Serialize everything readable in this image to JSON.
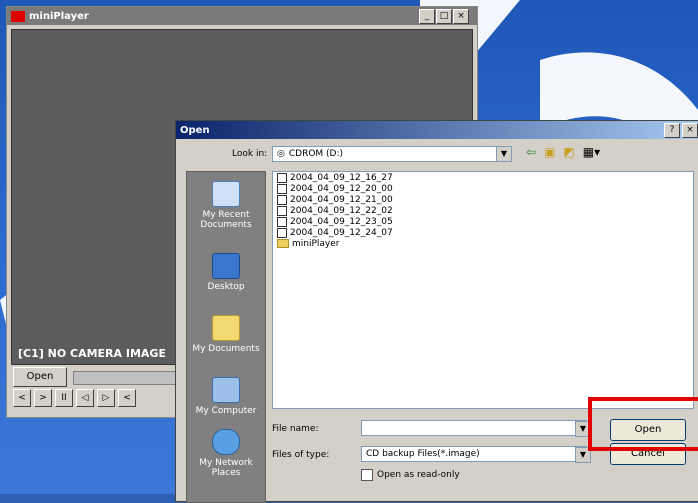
{
  "miniplayer": {
    "title": "miniPlayer",
    "status": "[C1] NO CAMERA IMAGE",
    "open_button": "Open",
    "controls": [
      "<",
      ">",
      "II",
      "◁",
      "▷",
      "<"
    ],
    "titlebar_buttons": [
      "_",
      "□",
      "×"
    ]
  },
  "dialog": {
    "title": "Open",
    "titlebar_buttons": [
      "?",
      "×"
    ],
    "look_in_label": "Look in:",
    "look_in_value": "CDROM (D:)",
    "places": [
      "My Recent Documents",
      "Desktop",
      "My Documents",
      "My Computer",
      "My Network Places"
    ],
    "files": [
      "2004_04_09_12_16_27",
      "2004_04_09_12_20_00",
      "2004_04_09_12_21_00",
      "2004_04_09_12_22_02",
      "2004_04_09_12_23_05",
      "2004_04_09_12_24_07"
    ],
    "folder": "miniPlayer",
    "file_name_label": "File name:",
    "file_name_value": "",
    "files_of_type_label": "Files of type:",
    "files_of_type_value": "CD backup Files(*.image)",
    "read_only_label": "Open as read-only",
    "open_button": "Open",
    "cancel_button": "Cancel"
  },
  "colors": {
    "highlight": "#e00000",
    "desktop": "#2d6cd0"
  }
}
